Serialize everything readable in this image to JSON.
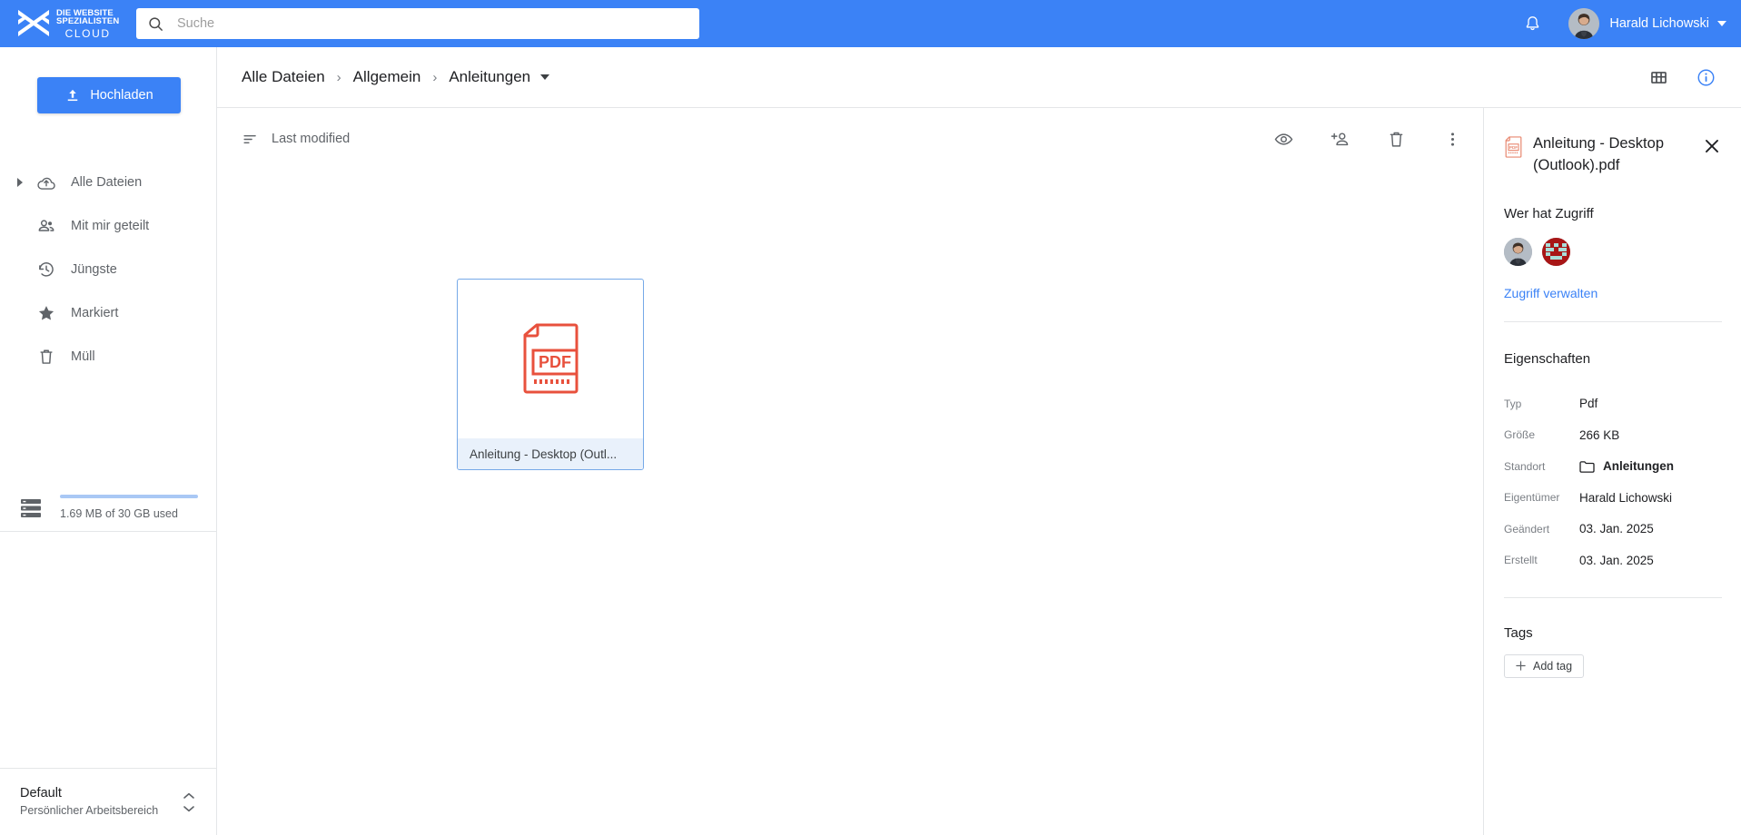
{
  "app": {
    "logo_line1": "DIE WEBSITE",
    "logo_line2": "SPEZIALISTEN",
    "logo_line3": "CLOUD",
    "accent_color": "#3b82f6",
    "pdf_color": "#e8513d"
  },
  "search": {
    "placeholder": "Suche",
    "value": ""
  },
  "header": {
    "notifications_icon": "bell-icon",
    "user_name": "Harald Lichowski",
    "user_menu_icon": "chevron-down-icon"
  },
  "sidebar": {
    "upload_label": "Hochladen",
    "upload_icon": "upload-icon",
    "items": [
      {
        "label": "Alle Dateien",
        "icon": "cloud-upload-icon",
        "expandable": true
      },
      {
        "label": "Mit mir geteilt",
        "icon": "people-icon",
        "expandable": false
      },
      {
        "label": "Jüngste",
        "icon": "history-clock-icon",
        "expandable": false
      },
      {
        "label": "Markiert",
        "icon": "star-icon",
        "expandable": false
      },
      {
        "label": "Müll",
        "icon": "trash-icon",
        "expandable": false
      }
    ],
    "storage": {
      "icon": "server-storage-icon",
      "text": "1.69 MB of 30 GB used",
      "used_percent": 100
    },
    "workspace": {
      "name": "Default",
      "subtitle": "Persönlicher Arbeitsbereich",
      "icon": "chevron-up-down-icon"
    }
  },
  "breadcrumb": {
    "items": [
      "Alle Dateien",
      "Allgemein",
      "Anleitungen"
    ],
    "separator": "›",
    "dropdown_icon": "caret-down-icon",
    "actions": [
      {
        "name": "grid-view-icon",
        "label": "Rasteransicht",
        "active": false
      },
      {
        "name": "info-icon",
        "label": "Details",
        "active": true
      }
    ]
  },
  "file_toolbar": {
    "sort_icon": "sort-icon",
    "sort_label": "Last modified",
    "actions": [
      {
        "name": "eye-icon",
        "label": "Vorschau"
      },
      {
        "name": "person-add-icon",
        "label": "Teilen"
      },
      {
        "name": "trash-icon",
        "label": "Löschen"
      },
      {
        "name": "more-vertical-icon",
        "label": "Mehr"
      }
    ]
  },
  "files": [
    {
      "name": "Anleitung - Desktop (Outl...",
      "type": "pdf",
      "icon_text": "PDF",
      "selected": true
    }
  ],
  "details": {
    "file_icon": "pdf-file-icon",
    "title": "Anleitung - Desktop (Outlook).pdf",
    "close_icon": "close-icon",
    "access_title": "Wer hat Zugriff",
    "manage_access_label": "Zugriff verwalten",
    "properties_title": "Eigenschaften",
    "properties": [
      {
        "key": "Typ",
        "value": "Pdf",
        "icon": null,
        "bold": false
      },
      {
        "key": "Größe",
        "value": "266 KB",
        "icon": null,
        "bold": false
      },
      {
        "key": "Standort",
        "value": "Anleitungen",
        "icon": "folder-icon",
        "bold": true
      },
      {
        "key": "Eigentümer",
        "value": "Harald Lichowski",
        "icon": null,
        "bold": false
      },
      {
        "key": "Geändert",
        "value": "03. Jan. 2025",
        "icon": null,
        "bold": false
      },
      {
        "key": "Erstellt",
        "value": "03. Jan. 2025",
        "icon": null,
        "bold": false
      }
    ],
    "tags_title": "Tags",
    "add_tag_label": "Add tag",
    "add_tag_icon": "plus-icon"
  }
}
